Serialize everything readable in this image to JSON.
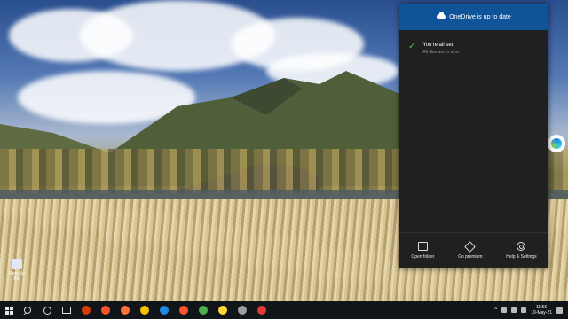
{
  "onedrive": {
    "header_title": "OneDrive is up to date",
    "status_title": "You're all set",
    "status_sub": "All files are in sync",
    "actions": [
      {
        "label": "Open folder",
        "icon": "folder-icon"
      },
      {
        "label": "Go premium",
        "icon": "diamond-icon"
      },
      {
        "label": "Help & Settings",
        "icon": "gear-icon"
      }
    ]
  },
  "desktop": {
    "icon_label": "Recycle Bin"
  },
  "taskbar": {
    "apps": [
      {
        "name": "office-icon",
        "color": "#d83b01"
      },
      {
        "name": "brave-icon",
        "color": "#fb542b"
      },
      {
        "name": "firefox-icon",
        "color": "#ff7139"
      },
      {
        "name": "chrome-canary-icon",
        "color": "#f2c200"
      },
      {
        "name": "edge-icon",
        "color": "#1e88e5"
      },
      {
        "name": "brave-beta-icon",
        "color": "#fb542b"
      },
      {
        "name": "chrome-icon",
        "color": "#4caf50"
      },
      {
        "name": "chrome-beta-icon",
        "color": "#fdd835"
      },
      {
        "name": "chrome-dev-icon",
        "color": "#9e9e9e"
      },
      {
        "name": "opera-icon",
        "color": "#e53935"
      }
    ],
    "time": "11:56",
    "date": "10-May-21"
  },
  "colors": {
    "header_bg": "#0f5399",
    "flyout_bg": "#202020",
    "check": "#3bbf5a"
  }
}
